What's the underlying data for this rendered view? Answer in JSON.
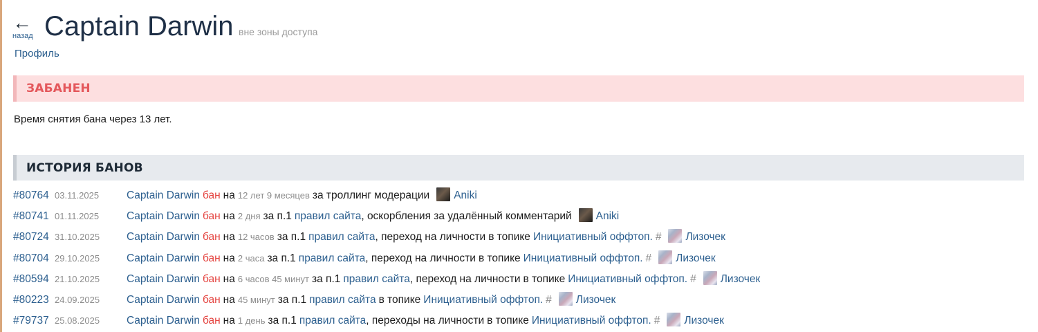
{
  "header": {
    "back_label": "назад",
    "title": "Captain Darwin",
    "status": "вне зоны доступа"
  },
  "profile_link": "Профиль",
  "banned": {
    "title": "ЗАБАНЕН",
    "info": "Время снятия бана через 13 лет."
  },
  "history": {
    "title": "ИСТОРИЯ БАНОВ",
    "rows": [
      {
        "id": "#80764",
        "date": "03.11.2025",
        "user": "Captain Darwin",
        "action": "бан",
        "on": "на",
        "duration": "12 лет 9 месяцев",
        "reason_prefix": "за троллинг модерации",
        "rules_link": "",
        "reason_text": "",
        "topic_prefix": "",
        "topic": "",
        "hash": "",
        "moderator": "Aniki",
        "avatar": "aniki"
      },
      {
        "id": "#80741",
        "date": "01.11.2025",
        "user": "Captain Darwin",
        "action": "бан",
        "on": "на",
        "duration": "2 дня",
        "reason_prefix": "за п.1",
        "rules_link": "правил сайта",
        "reason_text": ", оскорбления  за удалённый комментарий",
        "topic_prefix": "",
        "topic": "",
        "hash": "",
        "moderator": "Aniki",
        "avatar": "aniki"
      },
      {
        "id": "#80724",
        "date": "31.10.2025",
        "user": "Captain Darwin",
        "action": "бан",
        "on": "на",
        "duration": "12 часов",
        "reason_prefix": "за п.1",
        "rules_link": "правил сайта",
        "reason_text": ", переход на личности",
        "topic_prefix": "в топике",
        "topic": "Инициативный оффтоп.",
        "hash": "#",
        "moderator": "Лизочек",
        "avatar": "liz"
      },
      {
        "id": "#80704",
        "date": "29.10.2025",
        "user": "Captain Darwin",
        "action": "бан",
        "on": "на",
        "duration": "2 часа",
        "reason_prefix": "за п.1",
        "rules_link": "правил сайта",
        "reason_text": ", переход на личности",
        "topic_prefix": "в топике",
        "topic": "Инициативный оффтоп.",
        "hash": "#",
        "moderator": "Лизочек",
        "avatar": "liz"
      },
      {
        "id": "#80594",
        "date": "21.10.2025",
        "user": "Captain Darwin",
        "action": "бан",
        "on": "на",
        "duration": "6 часов 45 минут",
        "reason_prefix": "за п.1",
        "rules_link": "правил сайта",
        "reason_text": ", переход на личности",
        "topic_prefix": "в топике",
        "topic": "Инициативный оффтоп.",
        "hash": "#",
        "moderator": "Лизочек",
        "avatar": "liz"
      },
      {
        "id": "#80223",
        "date": "24.09.2025",
        "user": "Captain Darwin",
        "action": "бан",
        "on": "на",
        "duration": "45 минут",
        "reason_prefix": "за п.1",
        "rules_link": "правил сайта",
        "reason_text": "",
        "topic_prefix": "в топике",
        "topic": "Инициативный оффтоп.",
        "hash": "#",
        "moderator": "Лизочек",
        "avatar": "liz"
      },
      {
        "id": "#79737",
        "date": "25.08.2025",
        "user": "Captain Darwin",
        "action": "бан",
        "on": "на",
        "duration": "1 день",
        "reason_prefix": "за п.1",
        "rules_link": "правил сайта",
        "reason_text": ", переходы на личности",
        "topic_prefix": "в топике",
        "topic": "Инициативный оффтоп.",
        "hash": "#",
        "moderator": "Лизочек",
        "avatar": "liz"
      }
    ]
  }
}
